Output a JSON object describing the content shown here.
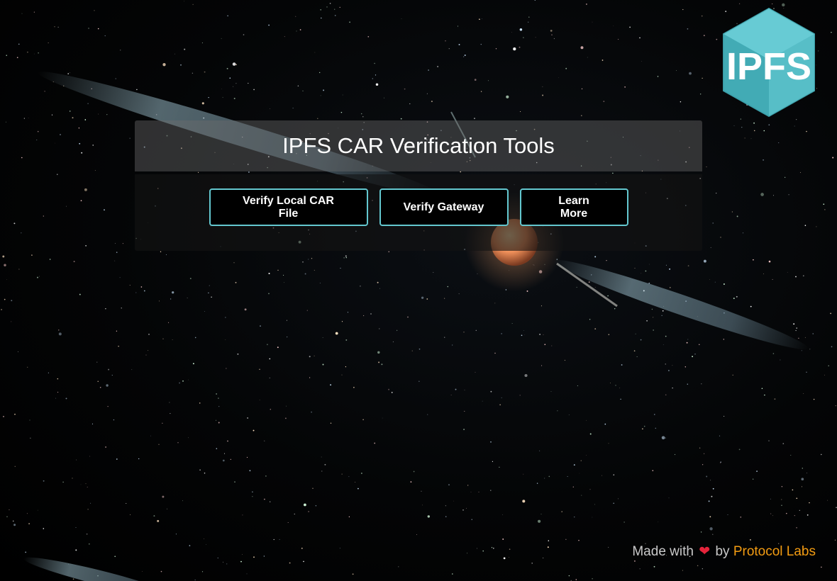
{
  "panel": {
    "title": "IPFS CAR Verification Tools"
  },
  "buttons": {
    "verify_local": "Verify Local CAR File",
    "verify_gateway": "Verify Gateway",
    "learn_more": "Learn More"
  },
  "logo": {
    "text": "IPFS"
  },
  "footer": {
    "prefix": "Made with",
    "heart": "❤",
    "by": "by",
    "link_text": "Protocol Labs"
  },
  "colors": {
    "accent": "#63c7cf",
    "link": "#f39c12",
    "heart": "#e5243b",
    "logo": "#4fb8c3"
  },
  "icons": [
    "ipfs-logo-icon",
    "heart-icon"
  ]
}
